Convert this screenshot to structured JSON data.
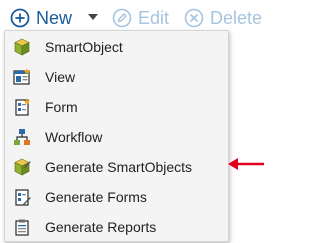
{
  "toolbar": {
    "new_label": "New",
    "edit_label": "Edit",
    "delete_label": "Delete"
  },
  "menu": {
    "items": [
      {
        "label": "SmartObject",
        "icon": "smartobject-icon"
      },
      {
        "label": "View",
        "icon": "view-icon"
      },
      {
        "label": "Form",
        "icon": "form-icon"
      },
      {
        "label": "Workflow",
        "icon": "workflow-icon"
      },
      {
        "label": "Generate SmartObjects",
        "icon": "generate-smartobjects-icon"
      },
      {
        "label": "Generate Forms",
        "icon": "generate-forms-icon"
      },
      {
        "label": "Generate Reports",
        "icon": "generate-reports-icon"
      }
    ]
  },
  "colors": {
    "new_blue": "#1a5b9e",
    "disabled_blue": "#a6c4e0",
    "menu_bg": "#f4f4f4",
    "annotation_arrow": "#e0001b"
  }
}
